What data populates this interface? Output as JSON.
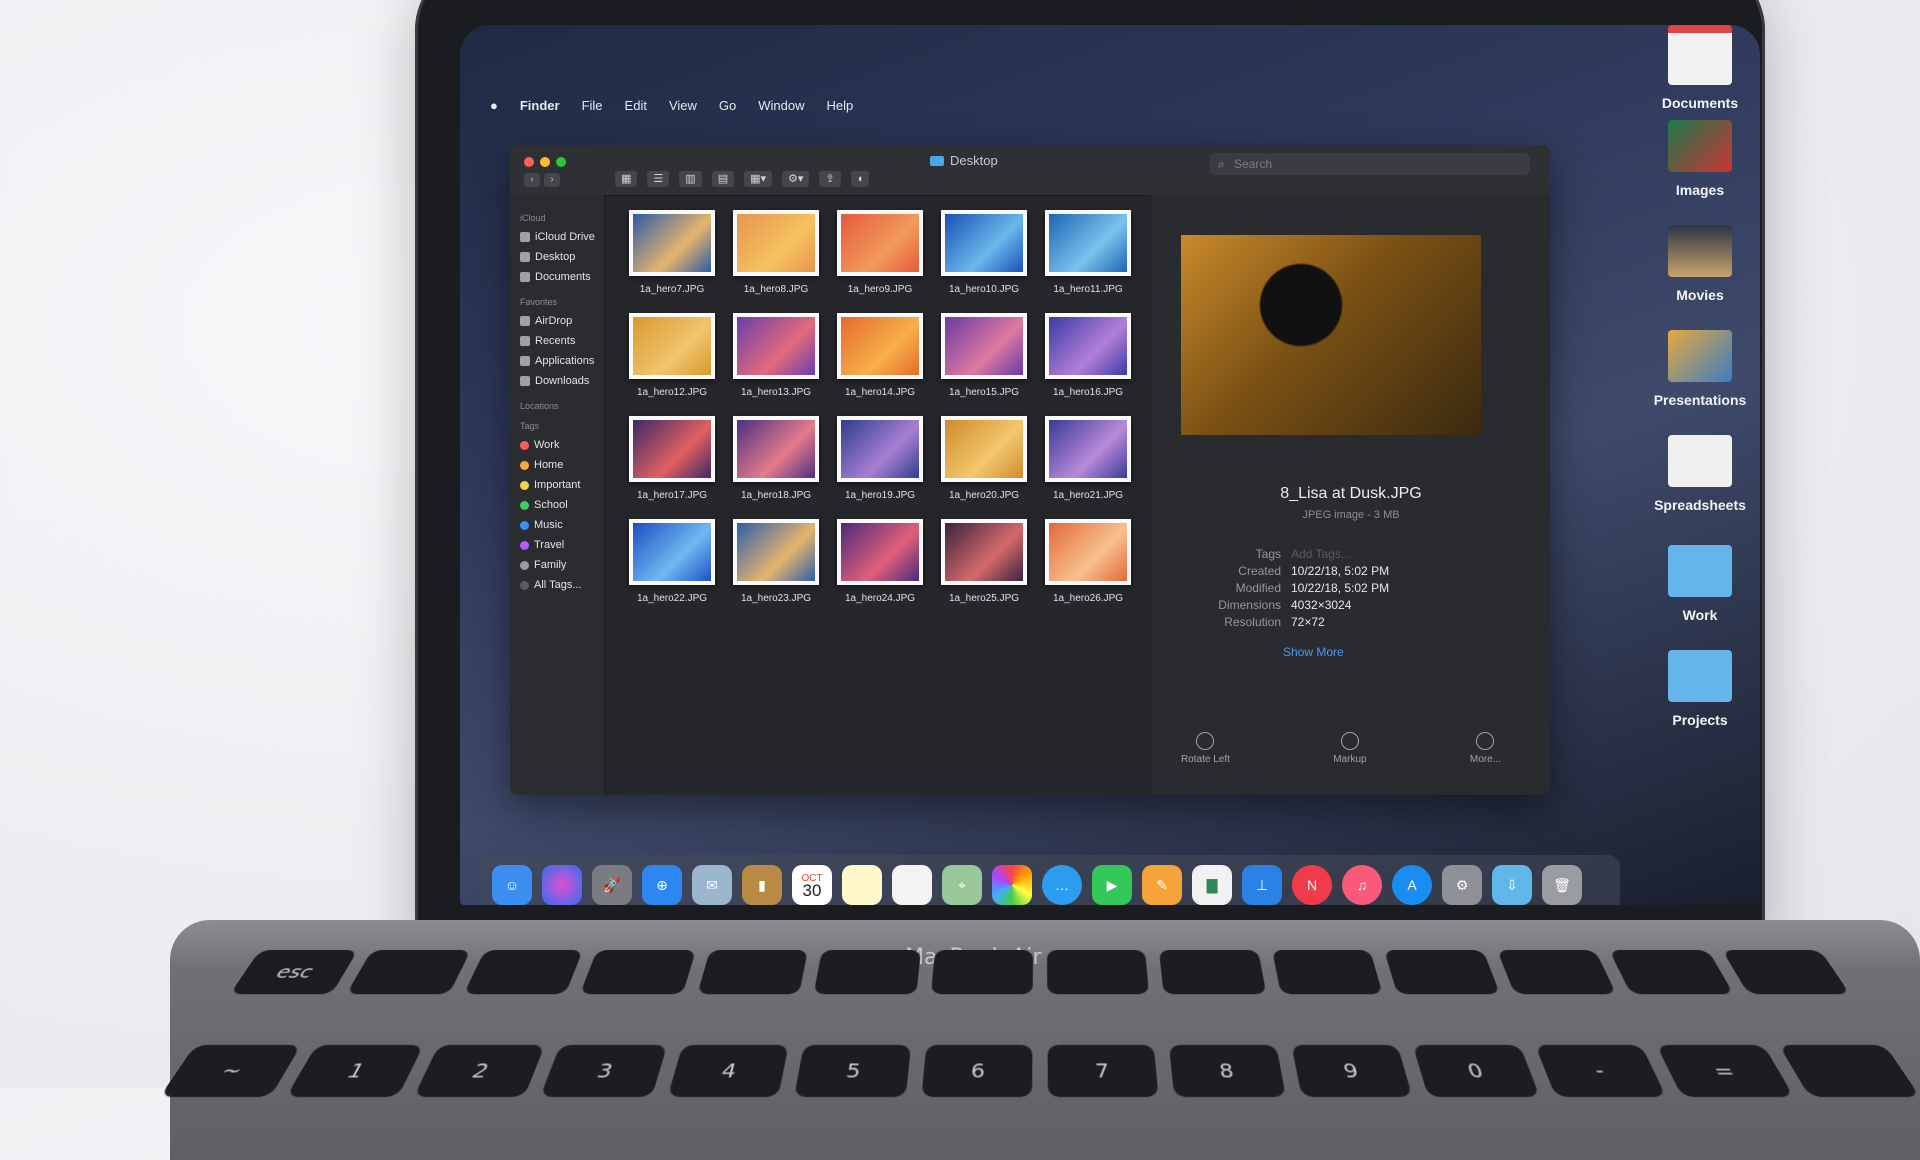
{
  "menubar": {
    "apple": "",
    "app": "Finder",
    "items": [
      "File",
      "Edit",
      "View",
      "Go",
      "Window",
      "Help"
    ]
  },
  "finder": {
    "title": "Desktop",
    "search_placeholder": "Search",
    "sidebar": {
      "sections": [
        {
          "header": "iCloud",
          "items": [
            "iCloud Drive",
            "Desktop",
            "Documents"
          ]
        },
        {
          "header": "Favorites",
          "items": [
            "AirDrop",
            "Recents",
            "Applications",
            "Downloads"
          ]
        },
        {
          "header": "Locations",
          "items": []
        }
      ],
      "tags_header": "Tags",
      "tags": [
        {
          "label": "Work",
          "color": "#ff5b5b"
        },
        {
          "label": "Home",
          "color": "#ffa63d"
        },
        {
          "label": "Important",
          "color": "#f2d34a"
        },
        {
          "label": "School",
          "color": "#3ecf5b"
        },
        {
          "label": "Music",
          "color": "#3a8dff"
        },
        {
          "label": "Travel",
          "color": "#b25bff"
        },
        {
          "label": "Family",
          "color": "#9a9ba0"
        },
        {
          "label": "All Tags...",
          "color": "#5a5b60"
        }
      ]
    },
    "files": [
      "1a_hero7.JPG",
      "1a_hero8.JPG",
      "1a_hero9.JPG",
      "1a_hero10.JPG",
      "1a_hero11.JPG",
      "1a_hero12.JPG",
      "1a_hero13.JPG",
      "1a_hero14.JPG",
      "1a_hero15.JPG",
      "1a_hero16.JPG",
      "1a_hero17.JPG",
      "1a_hero18.JPG",
      "1a_hero19.JPG",
      "1a_hero20.JPG",
      "1a_hero21.JPG",
      "1a_hero22.JPG",
      "1a_hero23.JPG",
      "1a_hero24.JPG",
      "1a_hero25.JPG",
      "1a_hero26.JPG"
    ],
    "preview": {
      "name": "8_Lisa at Dusk.JPG",
      "kind": "JPEG image - 3 MB",
      "tags_label": "Tags",
      "tags_placeholder": "Add Tags...",
      "created_label": "Created",
      "created": "10/22/18, 5:02 PM",
      "modified_label": "Modified",
      "modified": "10/22/18, 5:02 PM",
      "dimensions_label": "Dimensions",
      "dimensions": "4032×3024",
      "resolution_label": "Resolution",
      "resolution": "72×72",
      "show_more": "Show More",
      "actions": [
        "Rotate Left",
        "Markup",
        "More..."
      ]
    }
  },
  "desktop_stacks": [
    "Documents",
    "Images",
    "Movies",
    "Presentations",
    "Spreadsheets",
    "Work",
    "Projects"
  ],
  "dock": {
    "calendar_month": "OCT",
    "calendar_day": "30"
  },
  "laptop": {
    "model": "MacBook Air"
  }
}
